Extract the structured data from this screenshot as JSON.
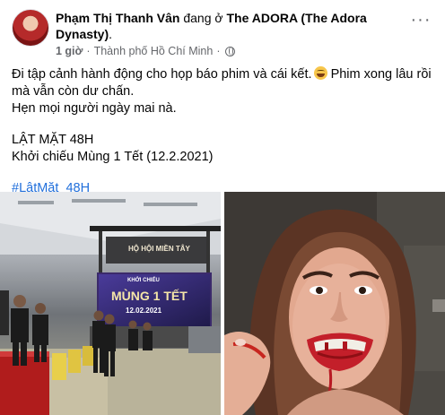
{
  "post": {
    "author": "Phạm Thị Thanh Vân",
    "checkin_prefix": "đang ở",
    "location": "The ADORA (The Adora Dynasty)",
    "location_suffix": ".",
    "time": "1 giờ",
    "separator": "·",
    "city": "Thành phố Hồ Chí Minh",
    "dot2": "·",
    "privacy_icon": "globe-icon",
    "more_label": "···",
    "text": {
      "line1": "Đi tập cảnh hành động cho họp báo phim và cái kết.",
      "line1_emoji": "grinning-sweat-emoji",
      "line1_cont": " Phim xong lâu rồi mà vẫn còn dư chấn.",
      "line2": "Hẹn mọi người ngày mai nà.",
      "line3": "LẬT MẶT 48H",
      "line4": "Khởi chiếu Mùng 1 Tết (12.2.2021)",
      "hashtag": "#LậtMặt_48H"
    }
  },
  "photos": {
    "left": {
      "alt": "event-hall-rehearsal-photo",
      "sign_top": "HỘ HỘI MIỀN TÂY",
      "screen_line1": "KHỞI CHIẾU",
      "screen_line2": "MÙNG 1 TẾT",
      "screen_line3": "12.02.2021"
    },
    "right": {
      "alt": "woman-with-fake-blood-selfie"
    }
  },
  "colors": {
    "link": "#216fdb",
    "secondary_text": "#65676b",
    "primary_text": "#050505"
  }
}
